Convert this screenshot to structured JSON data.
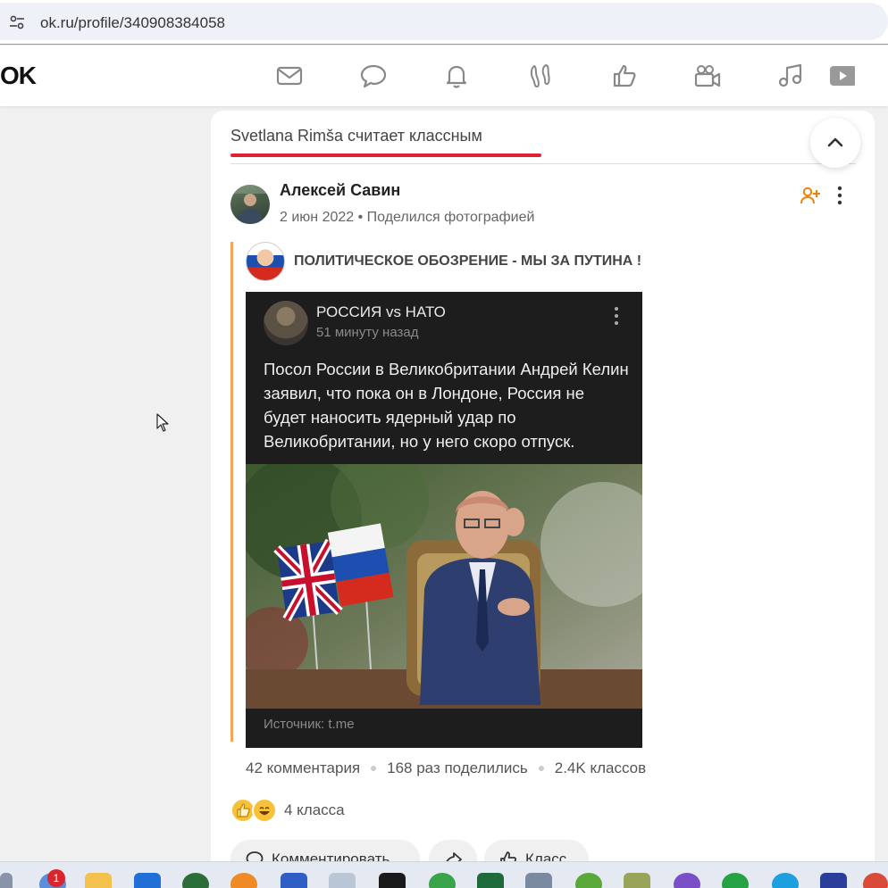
{
  "browser": {
    "url": "ok.ru/profile/340908384058",
    "site_icon": "site-settings-icon"
  },
  "nav": {
    "logo": "OK",
    "icons": [
      "messages-icon",
      "discussions-icon",
      "notifications-icon",
      "guests-icon",
      "reactions-icon",
      "video-icon",
      "music-icon",
      "video-play-icon"
    ]
  },
  "feed": {
    "header": "Svetlana Rimša считает классным"
  },
  "post": {
    "author": "Алексей Савин",
    "date": "2 июн 2022",
    "meta_sep": " • ",
    "action": "Поделился фотографией",
    "group_name": "ПОЛИТИЧЕСКОЕ ОБОЗРЕНИЕ - МЫ ЗА ПУТИНА !",
    "embed": {
      "channel": "РОССИЯ vs НАТО",
      "time": "51 минуту назад",
      "text": "Посол России в Великобритании Андрей Келин заявил, что пока он в Лондоне, Россия не будет наносить ядерный удар по Великобритании, но у него скоро отпуск.",
      "source": "Источник: t.me"
    },
    "stats": {
      "comments": "42 комментария",
      "shares": "168 раз поделились",
      "likes": "2.4K классов"
    },
    "reactions_count": "4 класса",
    "buttons": {
      "comment": "Комментировать",
      "share": "",
      "like": "Класс"
    }
  },
  "taskbar": {
    "badge": "1"
  },
  "colors": {
    "accent_red": "#e02131",
    "accent_orange": "#ee8208",
    "repost_line": "#f5a55a"
  }
}
